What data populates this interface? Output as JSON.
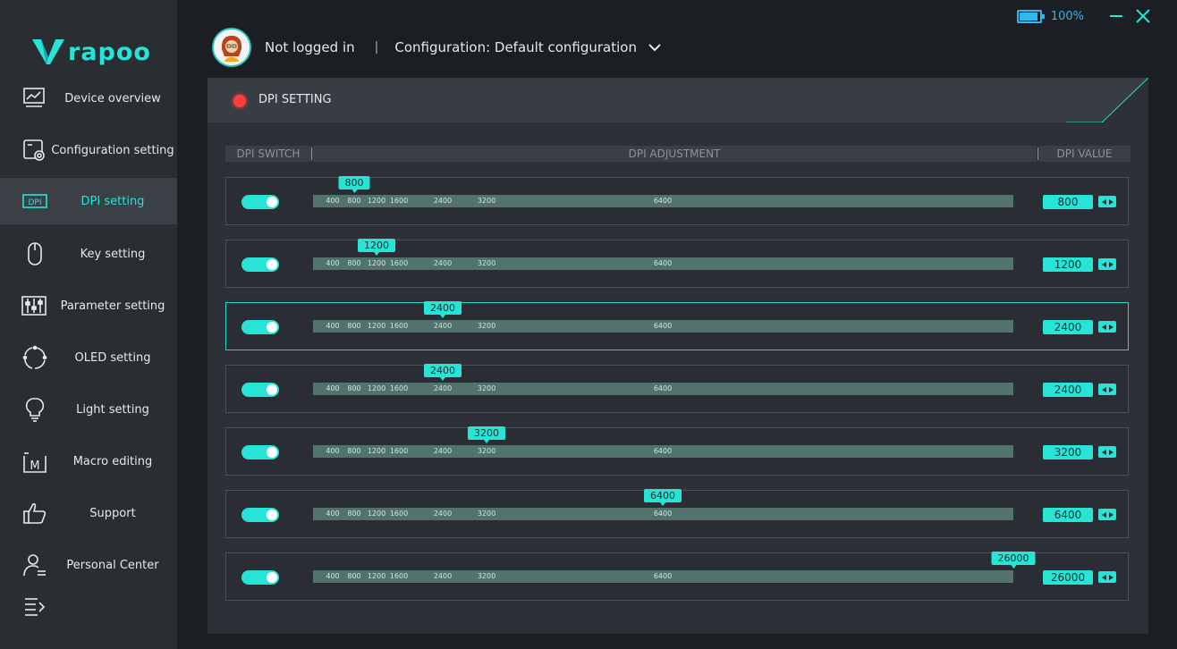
{
  "app": {
    "logo_text": "rapoo"
  },
  "window": {
    "battery_text": "100%",
    "battery_level": 1.0
  },
  "header": {
    "login_status": "Not logged in",
    "separator": "|",
    "configuration": "Configuration: Default configuration"
  },
  "sidebar": {
    "items": [
      {
        "label": "Device overview",
        "icon": "monitor-chart-icon",
        "active": false
      },
      {
        "label": "Configuration setting",
        "icon": "config-gear-icon",
        "active": false
      },
      {
        "label": "DPI setting",
        "icon": "dpi-icon",
        "active": true
      },
      {
        "label": "Key setting",
        "icon": "mouse-icon",
        "active": false
      },
      {
        "label": "Parameter setting",
        "icon": "sliders-icon",
        "active": false
      },
      {
        "label": "OLED setting",
        "icon": "oled-cycle-icon",
        "active": false
      },
      {
        "label": "Light setting",
        "icon": "lightbulb-icon",
        "active": false
      },
      {
        "label": "Macro editing",
        "icon": "macro-icon",
        "active": false
      },
      {
        "label": "Support",
        "icon": "thumbs-up-icon",
        "active": false
      },
      {
        "label": "Personal Center",
        "icon": "person-icon",
        "active": false
      }
    ]
  },
  "panel": {
    "title": "DPI SETTING",
    "columns": {
      "switch": "DPI SWITCH",
      "adjustment": "DPI ADJUSTMENT",
      "value": "DPI VALUE"
    }
  },
  "dpi": {
    "min": 400,
    "max": 26000,
    "ticks": [
      "400",
      "800",
      "1200",
      "1600",
      "2400",
      "3200",
      "6400"
    ],
    "rows": [
      {
        "enabled": true,
        "value": "800",
        "selected": false
      },
      {
        "enabled": true,
        "value": "1200",
        "selected": false
      },
      {
        "enabled": true,
        "value": "2400",
        "selected": true
      },
      {
        "enabled": true,
        "value": "2400",
        "selected": false
      },
      {
        "enabled": true,
        "value": "3200",
        "selected": false
      },
      {
        "enabled": true,
        "value": "6400",
        "selected": false
      },
      {
        "enabled": true,
        "value": "26000",
        "selected": false
      }
    ]
  }
}
